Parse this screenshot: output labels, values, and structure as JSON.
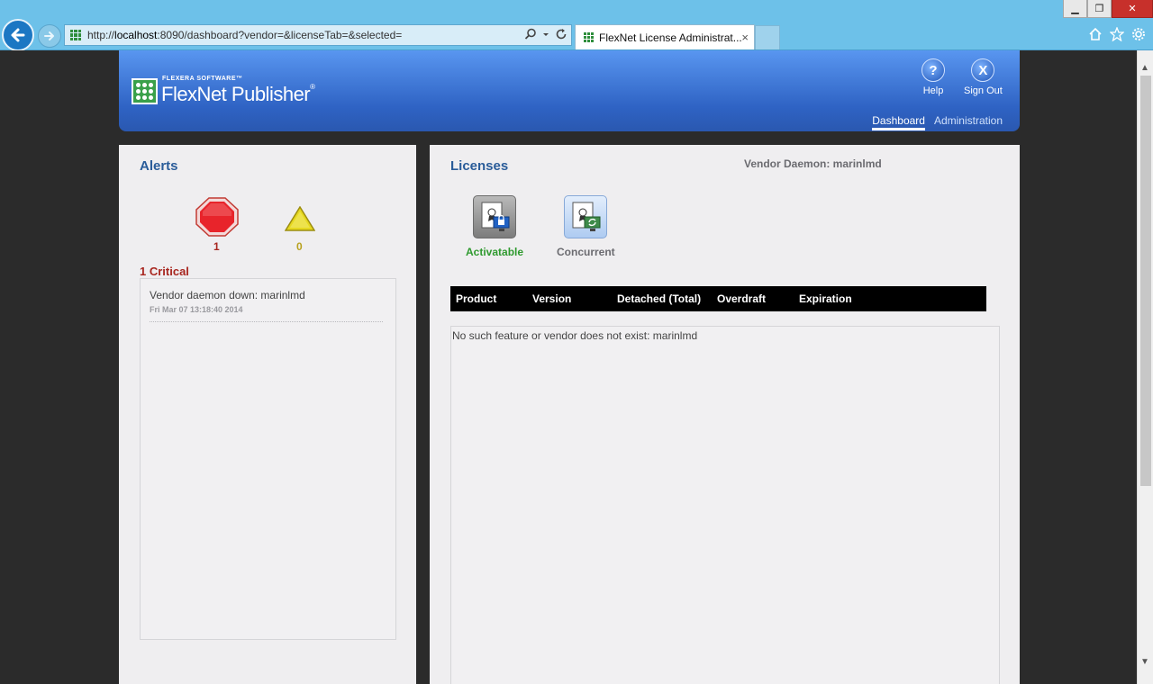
{
  "browser": {
    "url_prefix": "http://",
    "url_host": "localhost",
    "url_rest": ":8090/dashboard?vendor=&licenseTab=&selected=",
    "tab_title": "FlexNet License Administrat...",
    "tab_close": "×"
  },
  "window_controls": {
    "minimize": "▁",
    "restore": "❐",
    "close": "✕"
  },
  "header": {
    "brand_sub": "FLEXERA SOFTWARE™",
    "brand_name": "FlexNet Publisher",
    "brand_mark": "®",
    "help_label": "Help",
    "help_glyph": "?",
    "signout_label": "Sign Out",
    "signout_glyph": "X",
    "tabs": [
      {
        "label": "Dashboard",
        "active": true
      },
      {
        "label": "Administration",
        "active": false
      }
    ]
  },
  "alerts": {
    "title": "Alerts",
    "critical_count": "1",
    "warning_count": "0",
    "critical_header": "1 Critical",
    "items": [
      {
        "message": "Vendor daemon down: marinlmd",
        "timestamp": "Fri Mar 07 13:18:40 2014"
      }
    ]
  },
  "licenses": {
    "title": "Licenses",
    "vendor_daemon": "Vendor Daemon: marinlmd",
    "tabs": [
      {
        "label": "Activatable",
        "color": "#2f9a2f"
      },
      {
        "label": "Concurrent",
        "color": "#6b6b70"
      }
    ],
    "columns": [
      "Product",
      "Version",
      "Detached (Total)",
      "Overdraft",
      "Expiration"
    ],
    "empty_message": "No such feature or vendor does not exist: marinlmd"
  },
  "colors": {
    "critical": "#a8261f",
    "warning": "#b8a11f",
    "header_blue": "#2f63c4",
    "panel_title": "#2a5c99"
  },
  "icons": {
    "back": "back-arrow-icon",
    "forward": "forward-arrow-icon",
    "search": "search-icon",
    "refresh": "refresh-icon",
    "home": "home-icon",
    "favorites": "star-icon",
    "settings": "gear-icon"
  }
}
